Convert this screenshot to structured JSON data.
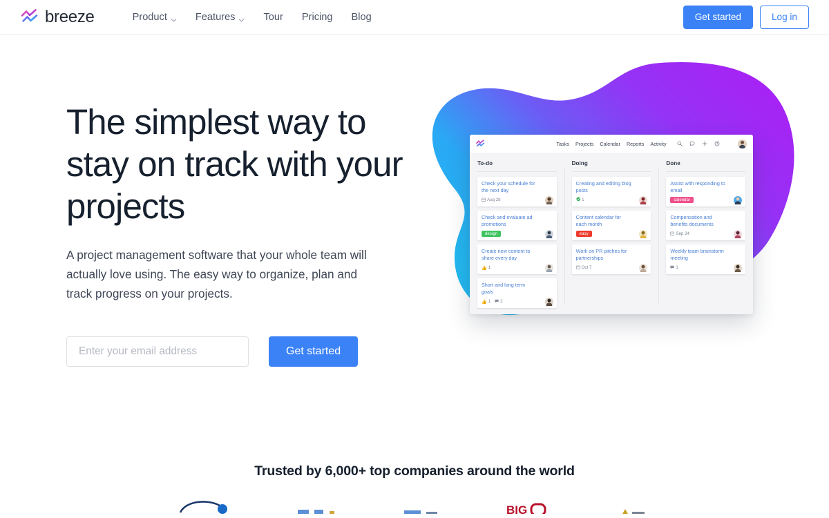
{
  "header": {
    "brand": "breeze",
    "brand_logo_icon": "breeze-zigzag-logo-icon",
    "nav": [
      {
        "label": "Product",
        "has_dropdown": true
      },
      {
        "label": "Features",
        "has_dropdown": true
      },
      {
        "label": "Tour",
        "has_dropdown": false
      },
      {
        "label": "Pricing",
        "has_dropdown": false
      },
      {
        "label": "Blog",
        "has_dropdown": false
      }
    ],
    "get_started_label": "Get started",
    "login_label": "Log in",
    "accent_color": "#3b82f6"
  },
  "hero": {
    "title": "The simplest way to stay on track with your projects",
    "subtitle": "A project management software that your whole team will actually love using. The easy way to organize, plan and track progress on your projects.",
    "email_placeholder": "Enter your email address",
    "email_value": "",
    "cta_label": "Get started"
  },
  "hero_art": {
    "blob_gradient": {
      "from": "#22b8f0",
      "mid": "#6d5bf5",
      "to": "#a723f5"
    },
    "app": {
      "logo_icon": "breeze-zigzag-logo-icon",
      "nav": [
        "Tasks",
        "Projects",
        "Calendar",
        "Reports",
        "Activity"
      ],
      "icons": [
        "search-icon",
        "chat-bubble-icon",
        "plus-icon",
        "help-circle-icon"
      ],
      "avatar": "user-avatar",
      "columns": [
        {
          "title": "To-do",
          "cards": [
            {
              "title": "Check your schedule for the next day",
              "date": "Aug 28",
              "date_icon": "calendar-icon",
              "tag": null,
              "tag_color": null,
              "likes": null,
              "comments": null,
              "checks": null,
              "avatar_color": "#8c6a52"
            },
            {
              "title": "Check and evaluate ad promotions",
              "date": null,
              "date_icon": null,
              "tag": "design",
              "tag_color": "#3dc35f",
              "likes": null,
              "comments": null,
              "checks": null,
              "avatar_color": "#4a5a74"
            },
            {
              "title": "Create new content to share every day",
              "date": null,
              "date_icon": null,
              "tag": null,
              "tag_color": null,
              "likes": "1",
              "comments": null,
              "checks": null,
              "avatar_color": "#9a8878"
            },
            {
              "title": "Short and long term goals",
              "date": null,
              "date_icon": null,
              "tag": null,
              "tag_color": null,
              "likes": "1",
              "comments": "2",
              "checks": null,
              "avatar_color": "#5c4a3f"
            }
          ]
        },
        {
          "title": "Doing",
          "cards": [
            {
              "title": "Creating and editing blog posts",
              "date": null,
              "date_icon": null,
              "tag": null,
              "tag_color": null,
              "likes": null,
              "comments": null,
              "checks": "1",
              "avatar_color": "#a8404a"
            },
            {
              "title": "Content calendar for each month",
              "date": null,
              "date_icon": null,
              "tag": "easy",
              "tag_color": "#ef3b2d",
              "likes": null,
              "comments": null,
              "checks": null,
              "avatar_color": "#e0b43c"
            },
            {
              "title": "Work on PR pitches for partnerships",
              "date": "Oct 7",
              "date_icon": "calendar-icon",
              "tag": null,
              "tag_color": null,
              "likes": null,
              "comments": null,
              "checks": null,
              "avatar_color": "#b39a84"
            }
          ]
        },
        {
          "title": "Done",
          "cards": [
            {
              "title": "Assist with responding to email",
              "date": null,
              "date_icon": null,
              "tag": "calendar",
              "tag_color": "#f0508c",
              "likes": null,
              "comments": null,
              "checks": null,
              "avatar_color": "#3f9fe0"
            },
            {
              "title": "Compensation and benefits documents",
              "date": "Sep 24",
              "date_icon": "calendar-icon",
              "tag": null,
              "tag_color": null,
              "likes": null,
              "comments": null,
              "checks": null,
              "avatar_color": "#b0445c"
            },
            {
              "title": "Weekly team brainstorm meeting",
              "date": null,
              "date_icon": null,
              "tag": null,
              "tag_color": null,
              "likes": null,
              "comments": "1",
              "checks": null,
              "avatar_color": "#7a604d"
            }
          ]
        }
      ]
    }
  },
  "trust": {
    "title": "Trusted by 6,000+ top companies around the world",
    "logos": [
      "partner-logo-1",
      "partner-logo-2",
      "partner-logo-3",
      "partner-logo-bigo",
      "partner-logo-5"
    ]
  }
}
